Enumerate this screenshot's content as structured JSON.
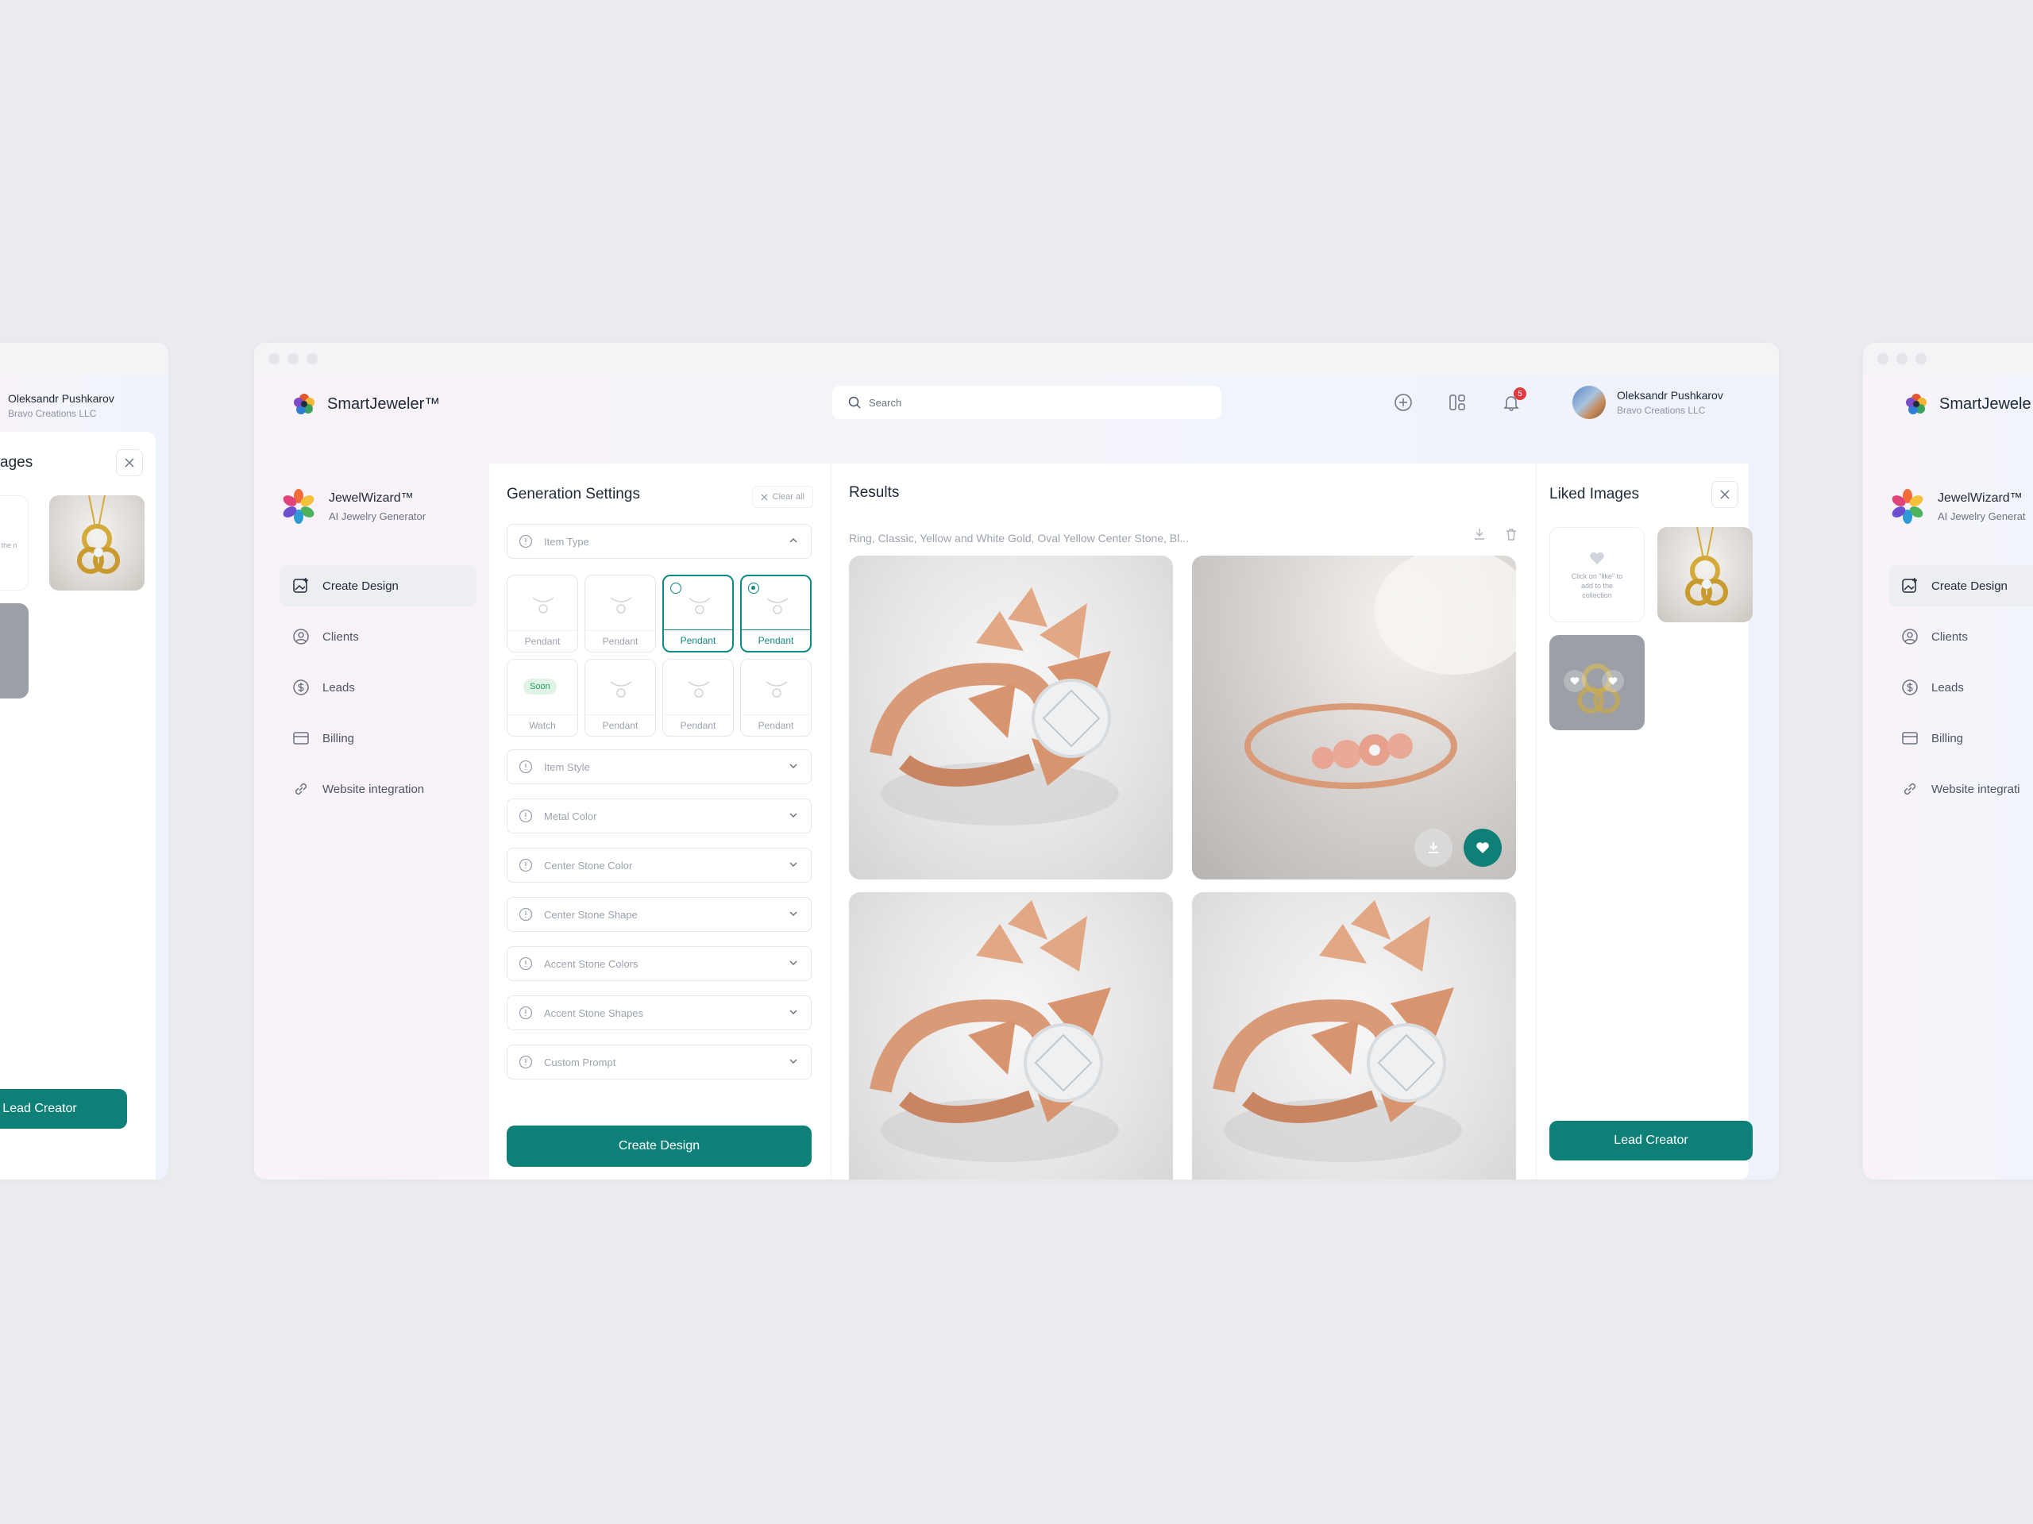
{
  "app": {
    "name": "SmartJeweler™"
  },
  "search": {
    "placeholder": "Search"
  },
  "notifications": {
    "count": "5"
  },
  "user": {
    "name": "Oleksandr Pushkarov",
    "org": "Bravo Creations LLC"
  },
  "brand": {
    "name": "JewelWizard™",
    "subtitle": "AI Jewelry Generator"
  },
  "nav": [
    {
      "label": "Create Design",
      "icon": "create-design-icon",
      "active": true
    },
    {
      "label": "Clients",
      "icon": "user-circle-icon"
    },
    {
      "label": "Leads",
      "icon": "dollar-circle-icon"
    },
    {
      "label": "Billing",
      "icon": "card-icon"
    },
    {
      "label": "Website integration",
      "icon": "link-icon"
    }
  ],
  "settings": {
    "title": "Generation Settings",
    "clear_label": "Clear all",
    "item_type": "Item Type",
    "tiles": [
      "Pendant",
      "Pendant",
      "Pendant",
      "Pendant",
      "Watch",
      "Pendant",
      "Pendant",
      "Pendant"
    ],
    "soon_label": "Soon",
    "fields": [
      "Item Style",
      "Metal Color",
      "Center Stone Color",
      "Center Stone Shape",
      "Accent Stone Colors",
      "Accent Stone Shapes",
      "Custom Prompt"
    ],
    "create_label": "Create Design"
  },
  "results": {
    "title": "Results",
    "prompt": "Ring, Classic, Yellow and White Gold, Oval Yellow Center Stone, Bl..."
  },
  "liked": {
    "title": "Liked Images",
    "hint": "Click on \"like\" to add to the collection",
    "lead_label": "Lead Creator"
  },
  "left_window": {
    "partial_title": "ages",
    "hint_fragment": "ike\" the n"
  },
  "right_window": {
    "app_name": "SmartJewele",
    "nav_last": "Website integrati",
    "brand_sub": "AI Jewelry Generat"
  },
  "colors": {
    "accent": "#0e8078",
    "badge": "#e0393e",
    "rose_gold": "#d99a78"
  }
}
